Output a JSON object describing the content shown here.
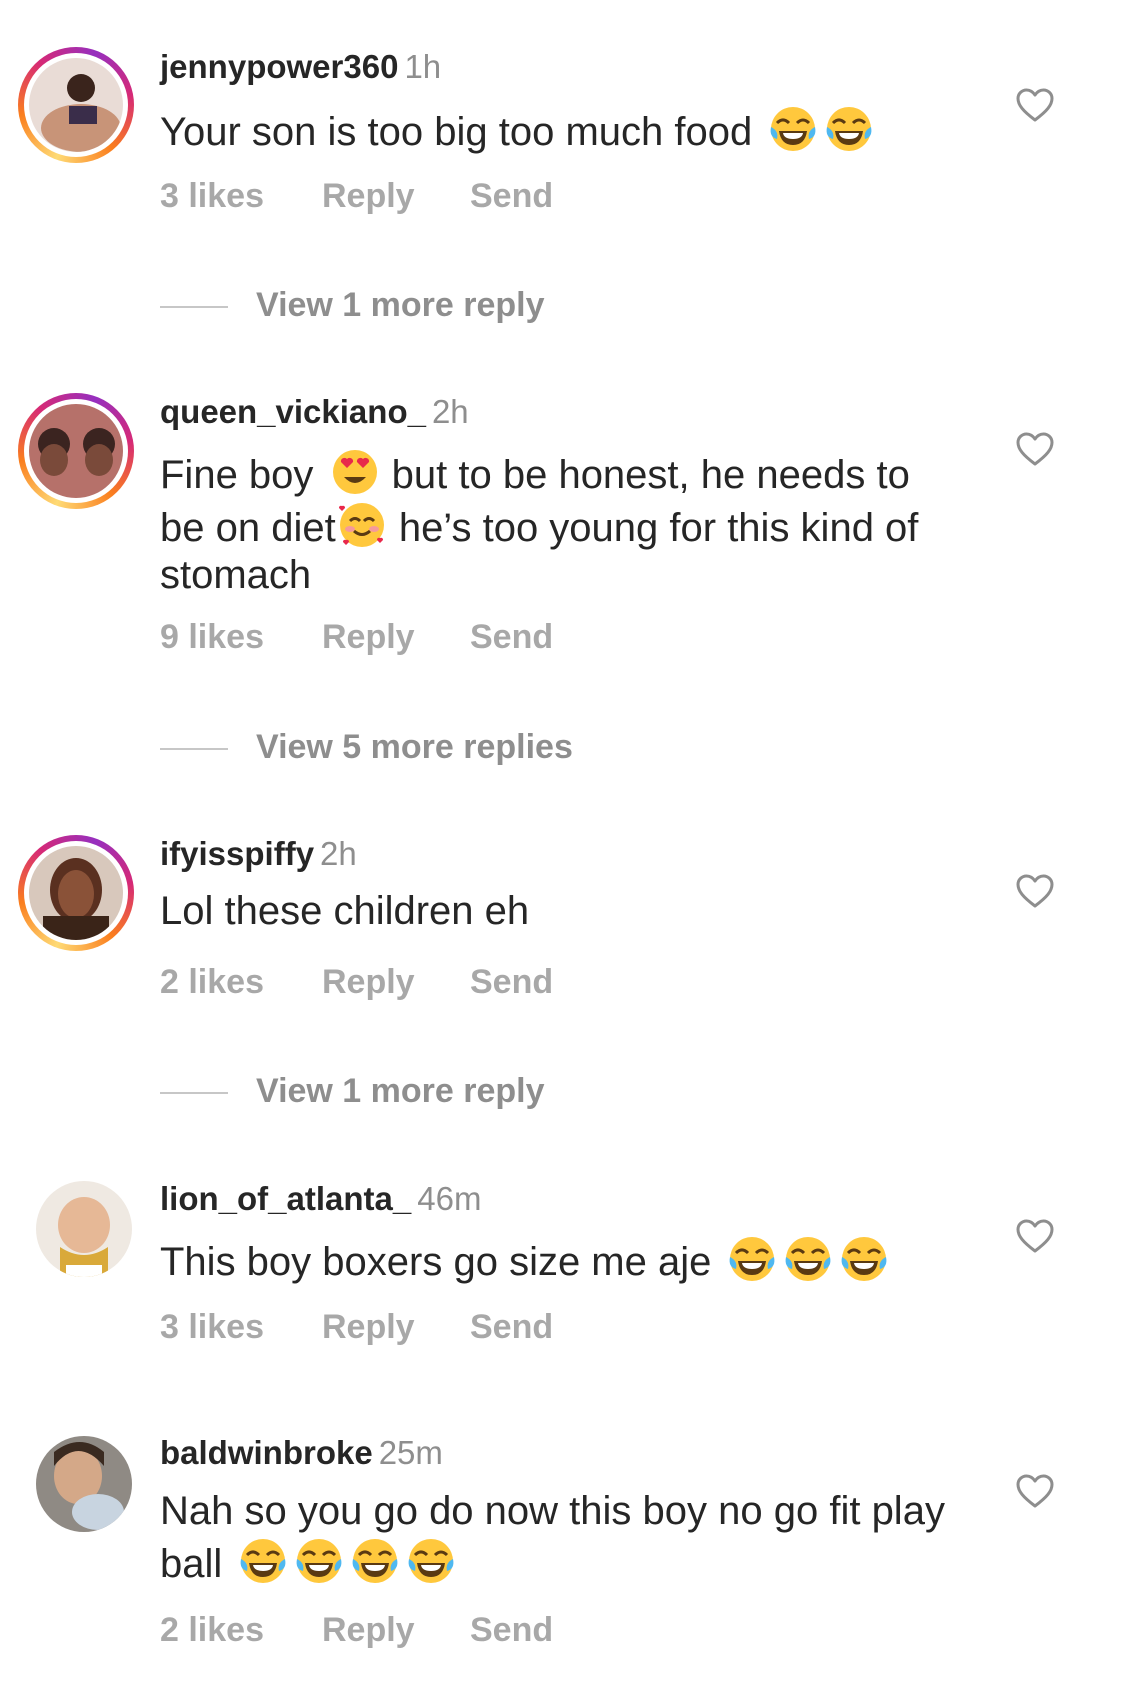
{
  "comments": [
    {
      "username": "jennypower360",
      "time": "1h",
      "text": "Your son is too big too much food ",
      "likes": "3 likes",
      "reply": "Reply",
      "send": "Send",
      "view_replies": "View 1 more reply",
      "emoji_trailing": "face-with-tears-of-joy x2"
    },
    {
      "username": "queen_vickiano_",
      "time": "2h",
      "text_part1": "Fine boy ",
      "text_part2": " but to be honest, he needs to be on diet",
      "text_part3": " he’s too young for this kind of stomach",
      "likes": "9 likes",
      "reply": "Reply",
      "send": "Send",
      "view_replies": "View 5 more replies"
    },
    {
      "username": "ifyisspiffy",
      "time": "2h",
      "text": "Lol these children eh",
      "likes": "2 likes",
      "reply": "Reply",
      "send": "Send",
      "view_replies": "View 1 more reply"
    },
    {
      "username": "lion_of_atlanta_",
      "time": "46m",
      "text": "This boy boxers go size me aje ",
      "likes": "3 likes",
      "reply": "Reply",
      "send": "Send"
    },
    {
      "username": "baldwinbroke",
      "time": "25m",
      "text": "Nah so you go do now this boy no go fit play ball ",
      "likes": "2 likes",
      "reply": "Reply",
      "send": "Send"
    }
  ],
  "colors": {
    "text": "#262626",
    "secondary": "#8e8e8e",
    "actions": "#a8a8a8",
    "ring_start": "#feda75",
    "ring_end": "#962fbf"
  }
}
